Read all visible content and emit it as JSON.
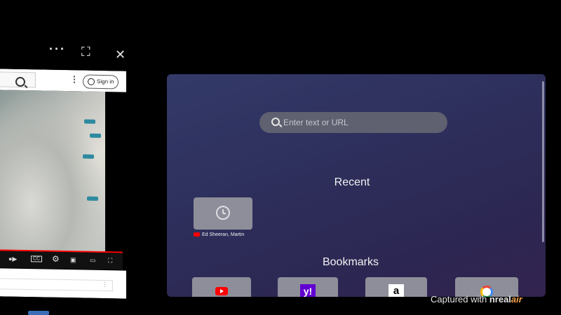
{
  "window_controls": {
    "more_label": "···",
    "fullscreen_label": "⛶",
    "close_label": "✕"
  },
  "youtube": {
    "sign_in_label": "Sign in",
    "menu_label": "⋮",
    "cc_label": "CC",
    "settings_label": "⚙",
    "bottom_menu_label": "⋮"
  },
  "search": {
    "placeholder": "Enter text or URL"
  },
  "recent": {
    "title": "Recent",
    "items": [
      {
        "caption": "Ed Sheeran, Martin"
      }
    ]
  },
  "bookmarks": {
    "title": "Bookmarks",
    "items": [
      {
        "icon": "youtube-icon"
      },
      {
        "icon": "yahoo-icon",
        "glyph": "y!"
      },
      {
        "icon": "amazon-icon",
        "glyph": "a"
      },
      {
        "icon": "google-icon"
      }
    ]
  },
  "watermark": {
    "prefix": "Captured with",
    "brand": "nreal",
    "suffix": "air"
  },
  "colors": {
    "panel_top": "#333a68",
    "panel_bottom": "#33234f",
    "tile": "#8e8e9a",
    "youtube_red": "#ff0000",
    "yahoo_purple": "#6001d2",
    "nreal_air_orange": "#f2a24a"
  }
}
